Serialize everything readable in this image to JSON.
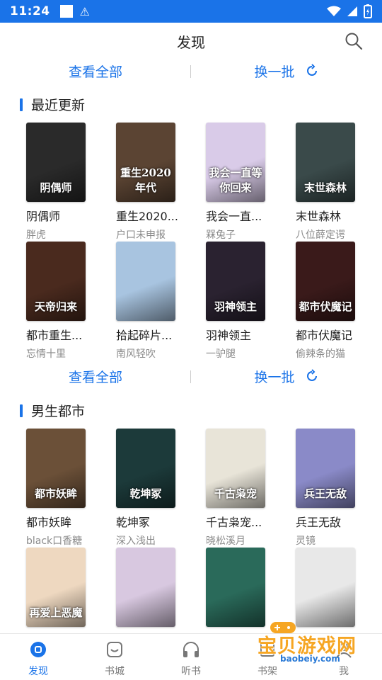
{
  "status_bar": {
    "time": "11:24"
  },
  "header": {
    "title": "发现"
  },
  "actions": {
    "view_all": "查看全部",
    "refresh": "换一批"
  },
  "sections": [
    {
      "title": "最近更新",
      "books": [
        {
          "name": "阴偶师",
          "author": "胖虎",
          "cover_text": "阴偶师",
          "bg": "#2a2a2a"
        },
        {
          "name": "重生2020...",
          "author": "户口未申报",
          "cover_text": "重生2020年代",
          "bg": "#5b4433"
        },
        {
          "name": "我会一直...",
          "author": "槑兔子",
          "cover_text": "我会一直等你回来",
          "bg": "#d9cbe8"
        },
        {
          "name": "末世森林",
          "author": "八位薛定谔",
          "cover_text": "末世森林",
          "bg": "#3a4a4a"
        },
        {
          "name": "都市重生...",
          "author": "忘情十里",
          "cover_text": "天帝归来",
          "bg": "#4a2a1e"
        },
        {
          "name": "拾起碎片...",
          "author": "南风轻吹",
          "cover_text": "",
          "bg": "#a8c4e0"
        },
        {
          "name": "羽神领主",
          "author": "一驴腿",
          "cover_text": "羽神领主",
          "bg": "#2a2230"
        },
        {
          "name": "都市伏魔记",
          "author": "偷辣条的猫",
          "cover_text": "都市伏魔记",
          "bg": "#3a1a1a"
        }
      ]
    },
    {
      "title": "男生都市",
      "books": [
        {
          "name": "都市妖眸",
          "author": "black口香糖",
          "cover_text": "都市妖眸",
          "bg": "#6b5038"
        },
        {
          "name": "乾坤冢",
          "author": "深入浅出",
          "cover_text": "乾坤冢",
          "bg": "#1c3a3a"
        },
        {
          "name": "千古枭宠...",
          "author": "晓松溪月",
          "cover_text": "千古枭宠",
          "bg": "#e8e4d8"
        },
        {
          "name": "兵王无敌",
          "author": "灵镜",
          "cover_text": "兵王无敌",
          "bg": "#8a8ac8"
        },
        {
          "name": "",
          "author": "",
          "cover_text": "再爱上恶魔",
          "bg": "#eed8c0"
        },
        {
          "name": "",
          "author": "",
          "cover_text": "",
          "bg": "#d8c8e0"
        },
        {
          "name": "",
          "author": "",
          "cover_text": "",
          "bg": "#2a6a5a"
        },
        {
          "name": "",
          "author": "",
          "cover_text": "",
          "bg": "#e8e8e8"
        }
      ]
    }
  ],
  "bottom_nav": [
    {
      "label": "发现",
      "icon": "discover-icon",
      "active": true
    },
    {
      "label": "书城",
      "icon": "bookstore-icon",
      "active": false
    },
    {
      "label": "听书",
      "icon": "headphones-icon",
      "active": false
    },
    {
      "label": "书架",
      "icon": "bookshelf-icon",
      "active": false
    },
    {
      "label": "我",
      "icon": "profile-icon",
      "active": false
    }
  ],
  "watermark": {
    "main": "宝贝游戏网",
    "sub": "baobeiy.com"
  },
  "colors": {
    "accent": "#1a73e8",
    "section_bar": "#1a73e8"
  }
}
